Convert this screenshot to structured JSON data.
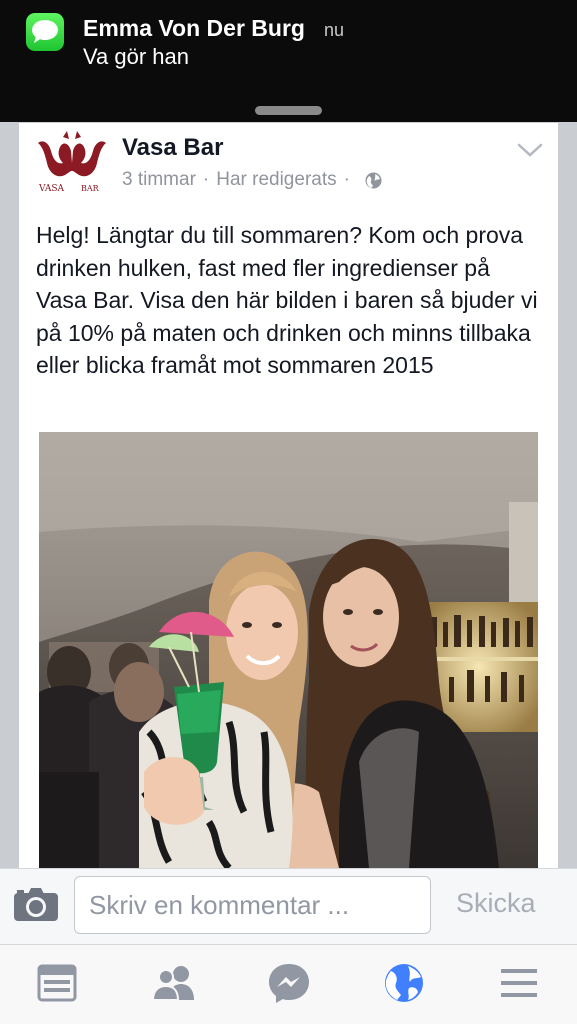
{
  "notification": {
    "sender": "Emma Von Der Burg",
    "time": "nu",
    "message": "Va gör han",
    "app_icon": "messages-icon"
  },
  "post": {
    "page_name": "Vasa Bar",
    "avatar_text": "VASA BAR",
    "time": "3 timmar",
    "edited": "Har redigerats",
    "audience_icon": "globe-icon",
    "text": "Helg! Längtar du till sommaren? Kom och prova drinken hulken, fast med fler ingredienser på Vasa Bar. Visa den här bilden i baren så bjuder vi på 10% på maten och drinken och minns tillbaka eller blicka framåt mot sommaren 2015"
  },
  "comment": {
    "placeholder": "Skriv en kommentar ...",
    "send_label": "Skicka"
  },
  "tabbar": {
    "items": [
      "news-feed-icon",
      "friends-icon",
      "messenger-icon",
      "globe-icon",
      "menu-icon"
    ],
    "active": "globe-icon"
  },
  "colors": {
    "accent": "#4080ff",
    "banner": "#0b0b0b",
    "inactive_icon": "#9197a3"
  }
}
